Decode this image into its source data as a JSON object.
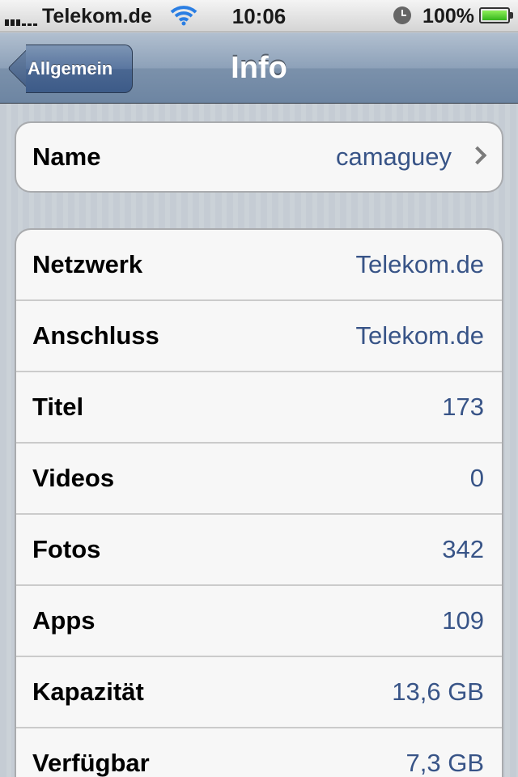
{
  "status_bar": {
    "carrier": "Telekom.de",
    "time": "10:06",
    "battery_percent": "100%",
    "signal_icon": "signal-bars-icon",
    "wifi_icon": "wifi-icon",
    "clock_icon": "alarm-clock-icon",
    "battery_icon": "battery-full-icon"
  },
  "nav": {
    "back_label": "Allgemein",
    "title": "Info"
  },
  "name_row": {
    "label": "Name",
    "value": "camaguey",
    "icon": "chevron-right-icon"
  },
  "info_rows": [
    {
      "label": "Netzwerk",
      "value": "Telekom.de"
    },
    {
      "label": "Anschluss",
      "value": "Telekom.de"
    },
    {
      "label": "Titel",
      "value": "173"
    },
    {
      "label": "Videos",
      "value": "0"
    },
    {
      "label": "Fotos",
      "value": "342"
    },
    {
      "label": "Apps",
      "value": "109"
    },
    {
      "label": "Kapazität",
      "value": "13,6 GB"
    },
    {
      "label": "Verfügbar",
      "value": "7,3 GB"
    }
  ],
  "colors": {
    "value_text": "#385487",
    "navbar": "#6d85a2",
    "background": "#c5ccd4"
  }
}
